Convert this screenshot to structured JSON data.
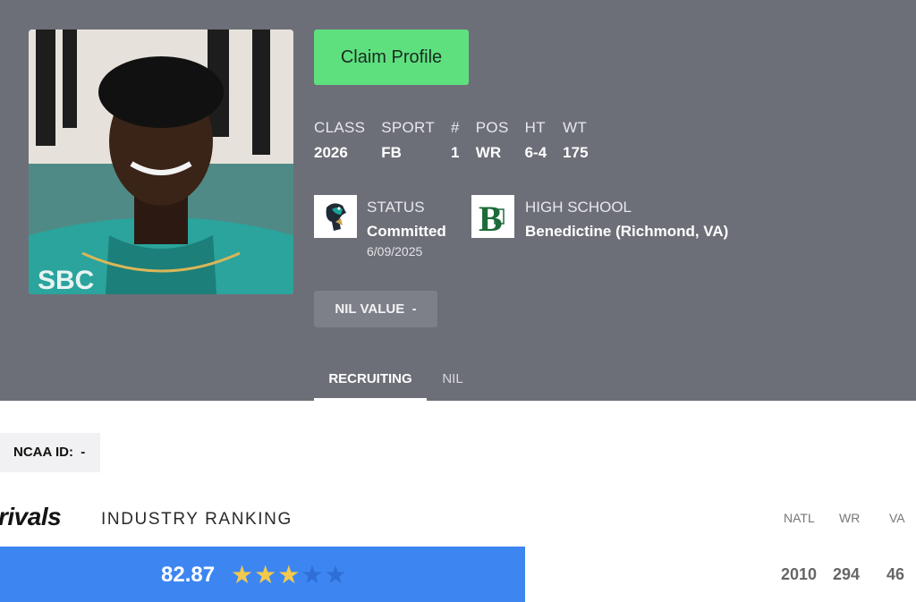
{
  "profile": {
    "claim_label": "Claim Profile",
    "stats": [
      {
        "label": "CLASS",
        "value": "2026"
      },
      {
        "label": "SPORT",
        "value": "FB"
      },
      {
        "label": "#",
        "value": "1"
      },
      {
        "label": "POS",
        "value": "WR"
      },
      {
        "label": "HT",
        "value": "6-4"
      },
      {
        "label": "WT",
        "value": "175"
      }
    ],
    "status": {
      "label": "STATUS",
      "value": "Committed",
      "date": "6/09/2025"
    },
    "high_school": {
      "label": "HIGH SCHOOL",
      "value": "Benedictine (Richmond, VA)"
    },
    "nil_label": "NIL VALUE",
    "nil_value": "-"
  },
  "tabs": [
    {
      "label": "RECRUITING",
      "active": true
    },
    {
      "label": "NIL",
      "active": false
    }
  ],
  "ncaa": {
    "label": "NCAA ID:",
    "value": "-"
  },
  "ranking": {
    "brand": "rivals",
    "title": "INDUSTRY RANKING",
    "score": "82.87",
    "stars_filled": 3,
    "stars_total": 5,
    "columns": [
      {
        "header": "NATL",
        "value": "2010"
      },
      {
        "header": "WR",
        "value": "294"
      },
      {
        "header": "VA",
        "value": "46"
      }
    ]
  },
  "colors": {
    "header_bg": "#6d6f78",
    "claim_bg": "#5ee07f",
    "rank_bar": "#3d86f2",
    "star": "#f2c94c"
  },
  "icons": {
    "status_logo": "chanticleer-logo",
    "school_logo": "benedictine-b-logo"
  }
}
